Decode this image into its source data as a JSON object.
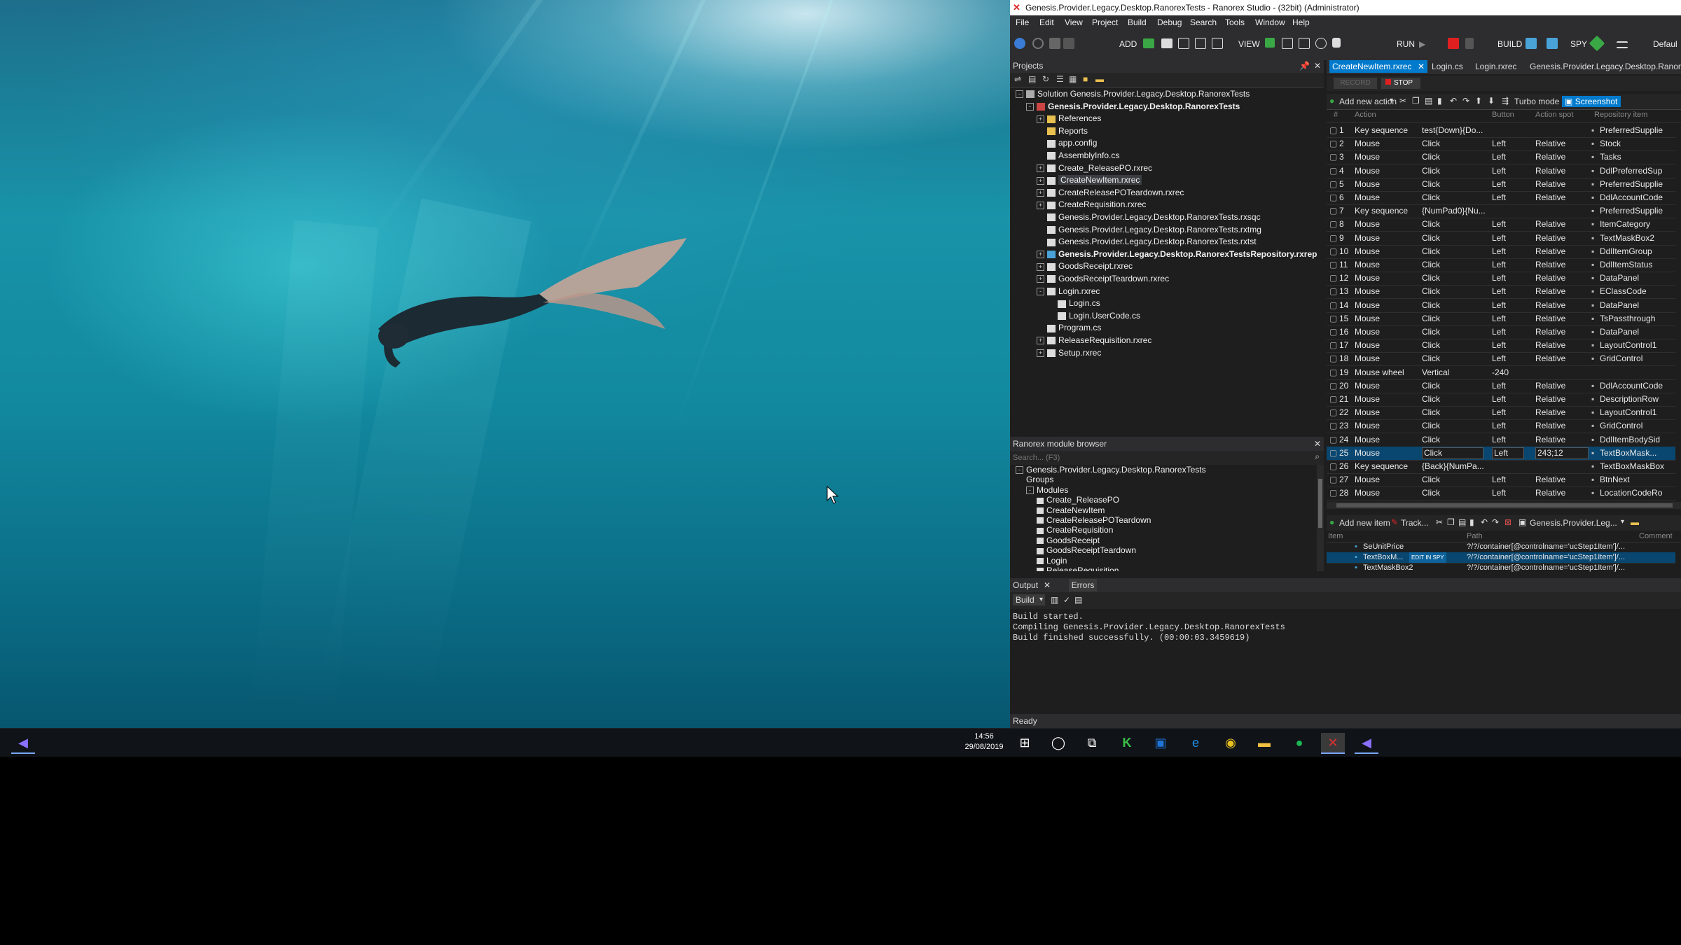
{
  "window": {
    "title": "Genesis.Provider.Legacy.Desktop.RanorexTests - Ranorex Studio - (32bit) (Administrator)"
  },
  "menu": [
    "File",
    "Edit",
    "View",
    "Project",
    "Build",
    "Debug",
    "Search",
    "Tools",
    "Window",
    "Help"
  ],
  "toolbar": {
    "add": "ADD",
    "view": "VIEW",
    "run": "RUN",
    "build": "BUILD",
    "spy": "SPY",
    "config": "Defaul"
  },
  "projects": {
    "title": "Projects",
    "items": [
      {
        "label": "Solution Genesis.Provider.Legacy.Desktop.RanorexTests",
        "indent": 0,
        "bold": false,
        "exp": "-",
        "icon": "solution-icon"
      },
      {
        "label": "Genesis.Provider.Legacy.Desktop.RanorexTests",
        "indent": 1,
        "bold": true,
        "exp": "-",
        "icon": "project-icon"
      },
      {
        "label": "References",
        "indent": 2,
        "bold": false,
        "exp": "+",
        "icon": "folder-icon"
      },
      {
        "label": "Reports",
        "indent": 2,
        "bold": false,
        "exp": "",
        "icon": "folder-icon"
      },
      {
        "label": "app.config",
        "indent": 2,
        "bold": false,
        "exp": "",
        "icon": "file-icon"
      },
      {
        "label": "AssemblyInfo.cs",
        "indent": 2,
        "bold": false,
        "exp": "",
        "icon": "file-icon"
      },
      {
        "label": "Create_ReleasePO.rxrec",
        "indent": 2,
        "bold": false,
        "exp": "+",
        "icon": "recording-icon"
      },
      {
        "label": "CreateNewItem.rxrec",
        "indent": 2,
        "bold": false,
        "exp": "+",
        "icon": "recording-icon",
        "selected": true
      },
      {
        "label": "CreateReleasePOTeardown.rxrec",
        "indent": 2,
        "bold": false,
        "exp": "+",
        "icon": "recording-icon"
      },
      {
        "label": "CreateRequisition.rxrec",
        "indent": 2,
        "bold": false,
        "exp": "+",
        "icon": "recording-icon"
      },
      {
        "label": "Genesis.Provider.Legacy.Desktop.RanorexTests.rxsqc",
        "indent": 2,
        "bold": false,
        "exp": "",
        "icon": "file-icon"
      },
      {
        "label": "Genesis.Provider.Legacy.Desktop.RanorexTests.rxtmg",
        "indent": 2,
        "bold": false,
        "exp": "",
        "icon": "file-icon"
      },
      {
        "label": "Genesis.Provider.Legacy.Desktop.RanorexTests.rxtst",
        "indent": 2,
        "bold": false,
        "exp": "",
        "icon": "file-icon"
      },
      {
        "label": "Genesis.Provider.Legacy.Desktop.RanorexTestsRepository.rxrep",
        "indent": 2,
        "bold": true,
        "exp": "+",
        "icon": "repository-icon"
      },
      {
        "label": "GoodsReceipt.rxrec",
        "indent": 2,
        "bold": false,
        "exp": "+",
        "icon": "recording-icon"
      },
      {
        "label": "GoodsReceiptTeardown.rxrec",
        "indent": 2,
        "bold": false,
        "exp": "+",
        "icon": "recording-icon"
      },
      {
        "label": "Login.rxrec",
        "indent": 2,
        "bold": false,
        "exp": "-",
        "icon": "recording-icon"
      },
      {
        "label": "Login.cs",
        "indent": 3,
        "bold": false,
        "exp": "",
        "icon": "file-icon"
      },
      {
        "label": "Login.UserCode.cs",
        "indent": 3,
        "bold": false,
        "exp": "",
        "icon": "file-icon"
      },
      {
        "label": "Program.cs",
        "indent": 2,
        "bold": false,
        "exp": "",
        "icon": "file-icon"
      },
      {
        "label": "ReleaseRequisition.rxrec",
        "indent": 2,
        "bold": false,
        "exp": "+",
        "icon": "recording-icon"
      },
      {
        "label": "Setup.rxrec",
        "indent": 2,
        "bold": false,
        "exp": "+",
        "icon": "recording-icon"
      }
    ]
  },
  "module_browser": {
    "title": "Ranorex module browser",
    "search_placeholder": "Search... (F3)",
    "items": [
      {
        "label": "Genesis.Provider.Legacy.Desktop.RanorexTests",
        "indent": 0,
        "exp": "-"
      },
      {
        "label": "Groups",
        "indent": 1,
        "exp": ""
      },
      {
        "label": "Modules",
        "indent": 1,
        "exp": "-"
      },
      {
        "label": "Create_ReleasePO",
        "indent": 2,
        "exp": ""
      },
      {
        "label": "CreateNewItem",
        "indent": 2,
        "exp": ""
      },
      {
        "label": "CreateReleasePOTeardown",
        "indent": 2,
        "exp": ""
      },
      {
        "label": "CreateRequisition",
        "indent": 2,
        "exp": ""
      },
      {
        "label": "GoodsReceipt",
        "indent": 2,
        "exp": ""
      },
      {
        "label": "GoodsReceiptTeardown",
        "indent": 2,
        "exp": ""
      },
      {
        "label": "Login",
        "indent": 2,
        "exp": ""
      },
      {
        "label": "ReleaseRequisition",
        "indent": 2,
        "exp": ""
      }
    ]
  },
  "tabs": [
    {
      "label": "CreateNewItem.rxrec",
      "active": true
    },
    {
      "label": "Login.cs",
      "active": false
    },
    {
      "label": "Login.rxrec",
      "active": false
    },
    {
      "label": "Genesis.Provider.Legacy.Desktop.RanorexTests",
      "active": false
    }
  ],
  "recorder": {
    "record": "RECORD",
    "stop": "STOP",
    "add_new_action": "Add new action",
    "turbo_mode": "Turbo mode",
    "screenshot": "Screenshot",
    "columns": [
      "#",
      "Action",
      "",
      "Button",
      "Action spot",
      "Repository item"
    ],
    "rows": [
      {
        "n": "1",
        "action": "Key sequence",
        "value": "test{Down}{Do...",
        "button": "",
        "spot": "",
        "repo": "PreferredSupplie"
      },
      {
        "n": "2",
        "action": "Mouse",
        "value": "Click",
        "button": "Left",
        "spot": "Relative",
        "repo": "Stock"
      },
      {
        "n": "3",
        "action": "Mouse",
        "value": "Click",
        "button": "Left",
        "spot": "Relative",
        "repo": "Tasks"
      },
      {
        "n": "4",
        "action": "Mouse",
        "value": "Click",
        "button": "Left",
        "spot": "Relative",
        "repo": "DdlPreferredSup"
      },
      {
        "n": "5",
        "action": "Mouse",
        "value": "Click",
        "button": "Left",
        "spot": "Relative",
        "repo": "PreferredSupplie"
      },
      {
        "n": "6",
        "action": "Mouse",
        "value": "Click",
        "button": "Left",
        "spot": "Relative",
        "repo": "DdlAccountCode"
      },
      {
        "n": "7",
        "action": "Key sequence",
        "value": "{NumPad0}{Nu...",
        "button": "",
        "spot": "",
        "repo": "PreferredSupplie"
      },
      {
        "n": "8",
        "action": "Mouse",
        "value": "Click",
        "button": "Left",
        "spot": "Relative",
        "repo": "ItemCategory"
      },
      {
        "n": "9",
        "action": "Mouse",
        "value": "Click",
        "button": "Left",
        "spot": "Relative",
        "repo": "TextMaskBox2"
      },
      {
        "n": "10",
        "action": "Mouse",
        "value": "Click",
        "button": "Left",
        "spot": "Relative",
        "repo": "DdlItemGroup"
      },
      {
        "n": "11",
        "action": "Mouse",
        "value": "Click",
        "button": "Left",
        "spot": "Relative",
        "repo": "DdlItemStatus"
      },
      {
        "n": "12",
        "action": "Mouse",
        "value": "Click",
        "button": "Left",
        "spot": "Relative",
        "repo": "DataPanel"
      },
      {
        "n": "13",
        "action": "Mouse",
        "value": "Click",
        "button": "Left",
        "spot": "Relative",
        "repo": "EClassCode"
      },
      {
        "n": "14",
        "action": "Mouse",
        "value": "Click",
        "button": "Left",
        "spot": "Relative",
        "repo": "DataPanel"
      },
      {
        "n": "15",
        "action": "Mouse",
        "value": "Click",
        "button": "Left",
        "spot": "Relative",
        "repo": "TsPassthrough"
      },
      {
        "n": "16",
        "action": "Mouse",
        "value": "Click",
        "button": "Left",
        "spot": "Relative",
        "repo": "DataPanel"
      },
      {
        "n": "17",
        "action": "Mouse",
        "value": "Click",
        "button": "Left",
        "spot": "Relative",
        "repo": "LayoutControl1"
      },
      {
        "n": "18",
        "action": "Mouse",
        "value": "Click",
        "button": "Left",
        "spot": "Relative",
        "repo": "GridControl"
      },
      {
        "n": "19",
        "action": "Mouse wheel",
        "value": "Vertical",
        "button": "-240",
        "spot": "",
        "repo": ""
      },
      {
        "n": "20",
        "action": "Mouse",
        "value": "Click",
        "button": "Left",
        "spot": "Relative",
        "repo": "DdlAccountCode"
      },
      {
        "n": "21",
        "action": "Mouse",
        "value": "Click",
        "button": "Left",
        "spot": "Relative",
        "repo": "DescriptionRow"
      },
      {
        "n": "22",
        "action": "Mouse",
        "value": "Click",
        "button": "Left",
        "spot": "Relative",
        "repo": "LayoutControl1"
      },
      {
        "n": "23",
        "action": "Mouse",
        "value": "Click",
        "button": "Left",
        "spot": "Relative",
        "repo": "GridControl"
      },
      {
        "n": "24",
        "action": "Mouse",
        "value": "Click",
        "button": "Left",
        "spot": "Relative",
        "repo": "DdlItemBodySid"
      },
      {
        "n": "25",
        "action": "Mouse",
        "value": "Click",
        "button": "Left",
        "spot": "243;12",
        "repo": "TextBoxMask...",
        "selected": true
      },
      {
        "n": "26",
        "action": "Key sequence",
        "value": "{Back}{NumPa...",
        "button": "",
        "spot": "",
        "repo": "TextBoxMaskBox"
      },
      {
        "n": "27",
        "action": "Mouse",
        "value": "Click",
        "button": "Left",
        "spot": "Relative",
        "repo": "BtnNext"
      },
      {
        "n": "28",
        "action": "Mouse",
        "value": "Click",
        "button": "Left",
        "spot": "Relative",
        "repo": "LocationCodeRo"
      }
    ]
  },
  "repository": {
    "add_new_item": "Add new item",
    "track": "Track...",
    "repo_name": "Genesis.Provider.Leg...",
    "columns": [
      "Item",
      "Path",
      "Comment"
    ],
    "rows": [
      {
        "item": "SeUnitPrice",
        "path": "?/?/container[@controlname='ucStep1Item']/...",
        "selected": false
      },
      {
        "item": "TextBoxM...",
        "path": "?/?/container[@controlname='ucStep1Item']/...",
        "selected": true,
        "badge": "EDIT IN SPY"
      },
      {
        "item": "TextMaskBox2",
        "path": "?/?/container[@controlname='ucStep1Item']/...",
        "selected": false
      }
    ]
  },
  "output": {
    "tabs": [
      "Output",
      "Errors"
    ],
    "filter": "Build",
    "lines": [
      "Build started.",
      "Compiling Genesis.Provider.Legacy.Desktop.RanorexTests",
      "Build finished successfully. (00:00:03.3459619)"
    ]
  },
  "status": {
    "text": "Ready"
  },
  "taskbar": {
    "time": "14:56",
    "date": "29/08/2019"
  }
}
